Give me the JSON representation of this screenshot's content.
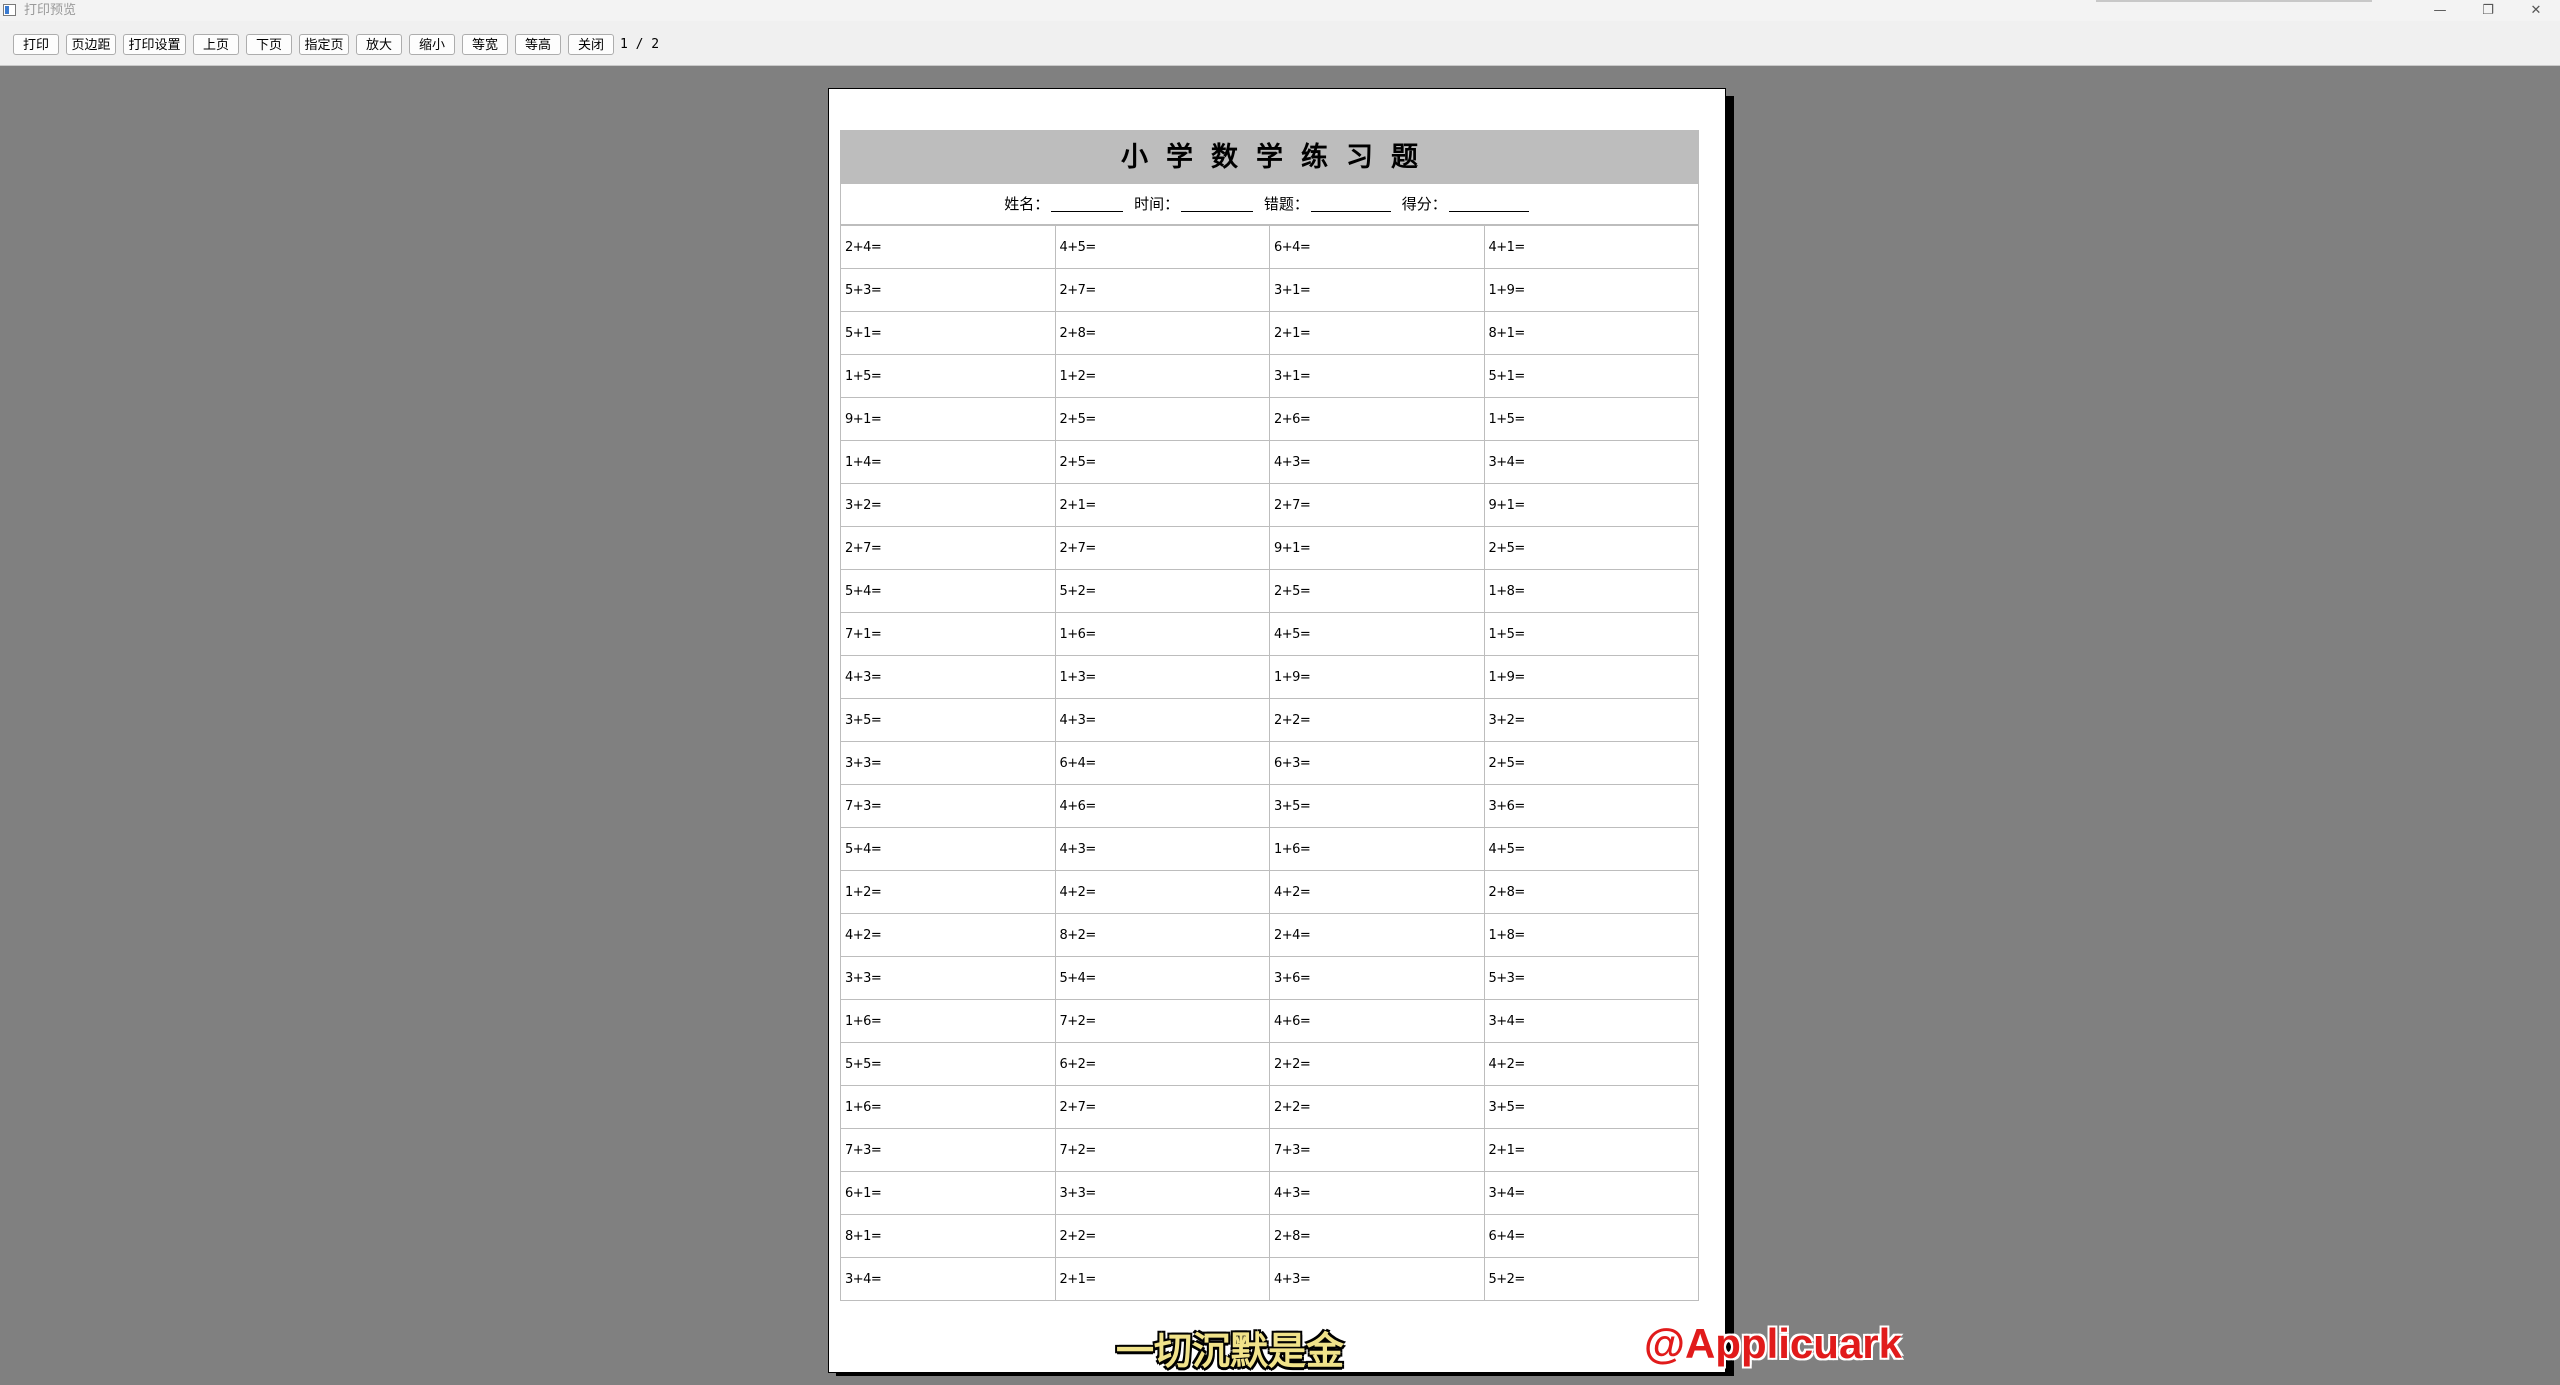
{
  "window": {
    "title": "打印预览",
    "minimize": "—",
    "restore": "❐",
    "close": "✕"
  },
  "toolbar": {
    "buttons": [
      "打印",
      "页边距",
      "打印设置",
      "上页",
      "下页",
      "指定页",
      "放大",
      "缩小",
      "等宽",
      "等高",
      "关闭"
    ],
    "page_indicator": "1 / 2"
  },
  "sheet": {
    "title": "小学数学练习题",
    "info": {
      "name_label": "姓名：",
      "time_label": "时间：",
      "wrong_label": "错题：",
      "score_label": "得分："
    },
    "rows": [
      [
        "2+4=",
        "4+5=",
        "6+4=",
        "4+1="
      ],
      [
        "5+3=",
        "2+7=",
        "3+1=",
        "1+9="
      ],
      [
        "5+1=",
        "2+8=",
        "2+1=",
        "8+1="
      ],
      [
        "1+5=",
        "1+2=",
        "3+1=",
        "5+1="
      ],
      [
        "9+1=",
        "2+5=",
        "2+6=",
        "1+5="
      ],
      [
        "1+4=",
        "2+5=",
        "4+3=",
        "3+4="
      ],
      [
        "3+2=",
        "2+1=",
        "2+7=",
        "9+1="
      ],
      [
        "2+7=",
        "2+7=",
        "9+1=",
        "2+5="
      ],
      [
        "5+4=",
        "5+2=",
        "2+5=",
        "1+8="
      ],
      [
        "7+1=",
        "1+6=",
        "4+5=",
        "1+5="
      ],
      [
        "4+3=",
        "1+3=",
        "1+9=",
        "1+9="
      ],
      [
        "3+5=",
        "4+3=",
        "2+2=",
        "3+2="
      ],
      [
        "3+3=",
        "6+4=",
        "6+3=",
        "2+5="
      ],
      [
        "7+3=",
        "4+6=",
        "3+5=",
        "3+6="
      ],
      [
        "5+4=",
        "4+3=",
        "1+6=",
        "4+5="
      ],
      [
        "1+2=",
        "4+2=",
        "4+2=",
        "2+8="
      ],
      [
        "4+2=",
        "8+2=",
        "2+4=",
        "1+8="
      ],
      [
        "3+3=",
        "5+4=",
        "3+6=",
        "5+3="
      ],
      [
        "1+6=",
        "7+2=",
        "4+6=",
        "3+4="
      ],
      [
        "5+5=",
        "6+2=",
        "2+2=",
        "4+2="
      ],
      [
        "1+6=",
        "2+7=",
        "2+2=",
        "3+5="
      ],
      [
        "7+3=",
        "7+2=",
        "7+3=",
        "2+1="
      ],
      [
        "6+1=",
        "3+3=",
        "4+3=",
        "3+4="
      ],
      [
        "8+1=",
        "2+2=",
        "2+8=",
        "6+4="
      ],
      [
        "3+4=",
        "2+1=",
        "4+3=",
        "5+2="
      ]
    ]
  },
  "overlay": {
    "caption": "一切沉默是金",
    "handle": "@Applicuark"
  }
}
